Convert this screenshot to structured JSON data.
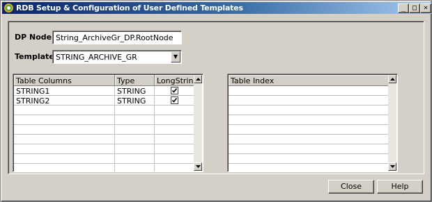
{
  "window": {
    "title": "RDB Setup & Configuration of User Defined Templates",
    "buttons": {
      "minimize": "_",
      "maximize": "□",
      "close": "×"
    }
  },
  "form": {
    "dp_node_label": "DP Node:",
    "dp_node_value": "String_ArchiveGr_DP.RootNode",
    "template_label": "Template:",
    "template_value": "STRING_ARCHIVE_GR"
  },
  "columns_table": {
    "headers": [
      "Table Columns",
      "Type",
      "LongString"
    ],
    "rows": [
      {
        "name": "STRING1",
        "type": "STRING",
        "long_string": true
      },
      {
        "name": "STRING2",
        "type": "STRING",
        "long_string": true
      },
      {
        "name": "",
        "type": "",
        "long_string": null
      },
      {
        "name": "",
        "type": "",
        "long_string": null
      },
      {
        "name": "",
        "type": "",
        "long_string": null
      },
      {
        "name": "",
        "type": "",
        "long_string": null
      },
      {
        "name": "",
        "type": "",
        "long_string": null
      },
      {
        "name": "",
        "type": "",
        "long_string": null
      },
      {
        "name": "",
        "type": "",
        "long_string": null
      }
    ]
  },
  "index_table": {
    "headers": [
      "Table Index"
    ],
    "rows": [
      "",
      "",
      "",
      "",
      "",
      "",
      "",
      "",
      ""
    ]
  },
  "footer": {
    "close_label": "Close",
    "help_label": "Help"
  },
  "colors": {
    "face": "#d4d0c8",
    "title_gradient_start": "#0a246a",
    "title_gradient_end": "#a6caf0"
  }
}
